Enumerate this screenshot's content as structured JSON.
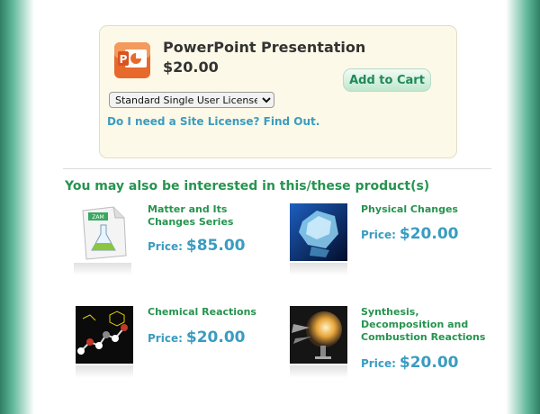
{
  "product": {
    "title": "PowerPoint Presentation",
    "price": "$20.00",
    "add_to_cart": "Add to Cart",
    "license_selected": "Standard Single User License",
    "site_license_link": "Do I need a Site License? Find Out."
  },
  "related": {
    "heading": "You may also be interested in this/these product(s)",
    "price_label": "Price:",
    "items": [
      {
        "title": "Matter and Its Changes Series",
        "price": "$85.00",
        "icon": "flask-document-icon"
      },
      {
        "title": "Physical Changes",
        "price": "$20.00",
        "icon": "ice-icon"
      },
      {
        "title": "Chemical Reactions",
        "price": "$20.00",
        "icon": "molecule-icon"
      },
      {
        "title": "Synthesis, Decomposition and Combustion Reactions",
        "price": "$20.00",
        "icon": "explosion-icon"
      }
    ]
  },
  "colors": {
    "accent_green": "#26944f",
    "link_blue": "#3a9cc0",
    "box_bg": "#fdf9e8"
  }
}
